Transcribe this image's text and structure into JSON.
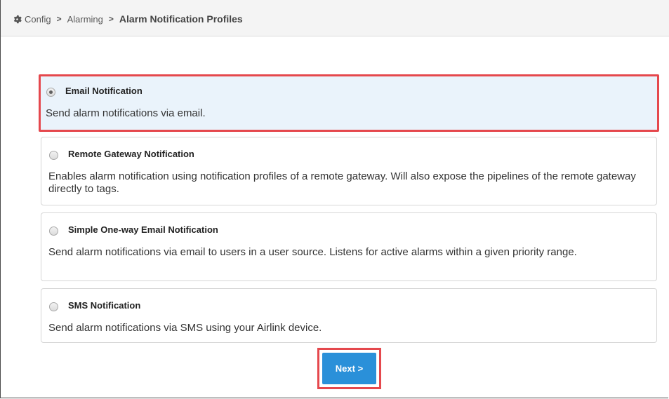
{
  "breadcrumb": {
    "items": [
      "Config",
      "Alarming"
    ],
    "separator": ">",
    "current": "Alarm Notification Profiles"
  },
  "options": [
    {
      "title": "Email Notification",
      "description": "Send alarm notifications via email.",
      "selected": true
    },
    {
      "title": "Remote Gateway Notification",
      "description": "Enables alarm notification using notification profiles of a remote gateway. Will also expose the pipelines of the remote gateway directly to tags.",
      "selected": false
    },
    {
      "title": "Simple One-way Email Notification",
      "description": "Send alarm notifications via email to users in a user source. Listens for active alarms within a given priority range.",
      "selected": false
    },
    {
      "title": "SMS Notification",
      "description": "Send alarm notifications via SMS using your Airlink device.",
      "selected": false
    }
  ],
  "actions": {
    "next_label": "Next >"
  },
  "colors": {
    "highlight": "#e5484d",
    "selected_bg": "#eaf3fb",
    "primary_button": "#2a90d9"
  }
}
